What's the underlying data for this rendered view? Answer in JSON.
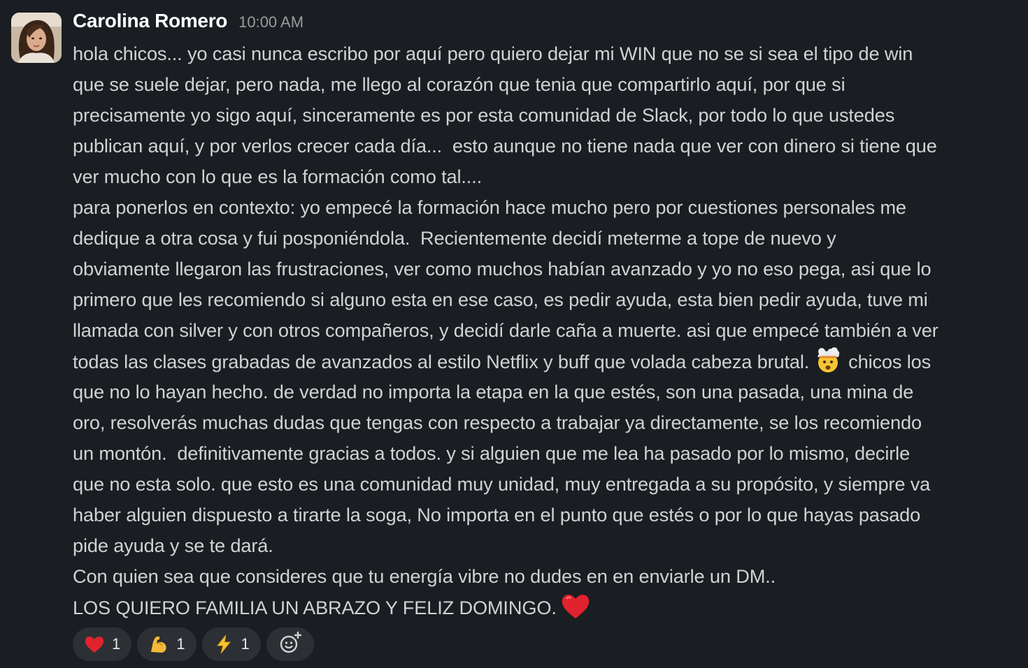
{
  "message": {
    "sender": "Carolina Romero",
    "timestamp": "10:00 AM",
    "lines": [
      "hola chicos... yo casi nunca escribo por aquí pero quiero dejar mi WIN que no se si sea el tipo de win",
      "que se suele dejar, pero nada, me llego al corazón que tenia que compartirlo aquí, por que si",
      "precisamente yo sigo aquí, sinceramente es por esta comunidad de Slack, por todo lo que ustedes",
      "publican aquí, y por verlos crecer cada día...  esto aunque no tiene nada que ver con dinero si tiene que",
      "ver mucho con lo que es la formación como tal....",
      "para ponerlos en contexto: yo empecé la formación hace mucho pero por cuestiones personales me",
      "dedique a otra cosa y fui posponiéndola.  Recientemente decidí meterme a tope de nuevo y",
      "obviamente llegaron las frustraciones, ver como muchos habían avanzado y yo no eso pega, asi que lo",
      "primero que les recomiendo si alguno esta en ese caso, es pedir ayuda, esta bien pedir ayuda, tuve mi",
      "llamada con silver y con otros compañeros, y decidí darle caña a muerte. asi que empecé también a ver"
    ],
    "line_emoji_before": "todas las clases grabadas de avanzados al estilo Netflix y buff que volada cabeza brutal.",
    "line_emoji_after": "chicos los",
    "lines_after": [
      "que no lo hayan hecho. de verdad no importa la etapa en la que estés, son una pasada, una mina de",
      "oro, resolverás muchas dudas que tengas con respecto a trabajar ya directamente, se los recomiendo",
      "un montón.  definitivamente gracias a todos. y si alguien que me lea ha pasado por lo mismo, decirle",
      "que no esta solo. que esto es una comunidad muy unidad, muy entregada a su propósito, y siempre va",
      "haber alguien dispuesto a tirarte la soga, No importa en el punto que estés o por lo que hayas pasado",
      "pide ayuda y se te dará.",
      "Con quien sea que consideres que tu energía vibre no dudes en en enviarle un DM..",
      "LOS QUIERO FAMILIA UN ABRAZO Y FELIZ DOMINGO."
    ],
    "inline_emoji_names": [
      "exploding-head-emoji",
      "red-heart-emoji"
    ]
  },
  "reactions": [
    {
      "emoji": "red-heart",
      "count": "1"
    },
    {
      "emoji": "flexed-biceps",
      "count": "1"
    },
    {
      "emoji": "high-voltage",
      "count": "1"
    }
  ],
  "add_reaction_icon": "add-reaction-icon",
  "colors": {
    "background": "#1a1d21",
    "text": "#d1d2d3",
    "sender": "#ffffff",
    "timestamp": "#9a9b9d",
    "reaction_pill": "#2c2f33"
  }
}
